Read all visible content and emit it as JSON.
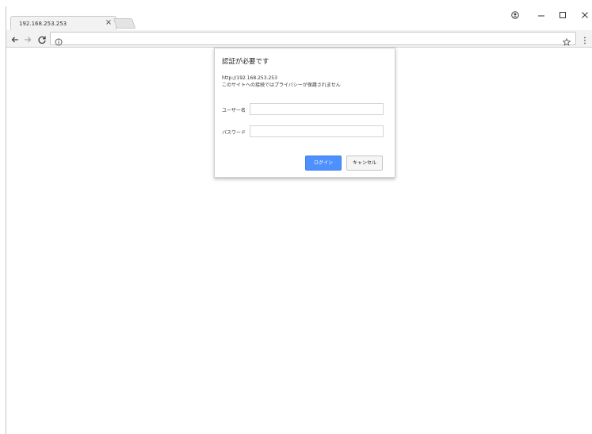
{
  "browser": {
    "tab": {
      "title": "192.168.253.253",
      "close_glyph": "×"
    },
    "window_controls": {
      "profile_icon": "profile-icon",
      "minimize_glyph": "–",
      "maximize_glyph": "☐",
      "close_glyph": "✕"
    },
    "toolbar": {
      "back_icon": "back-arrow-icon",
      "forward_icon": "forward-arrow-icon",
      "reload_icon": "reload-icon",
      "address_value": "",
      "info_icon": "info-icon",
      "star_icon": "star-icon",
      "menu_icon": "menu-icon"
    }
  },
  "auth_dialog": {
    "title": "認証が必要です",
    "url": "http://192.168.253.253",
    "warning": "このサイトへの接続ではプライバシーが保護されません",
    "username_label": "ユーザー名",
    "username_value": "",
    "password_label": "パスワード",
    "password_value": "",
    "login_button": "ログイン",
    "cancel_button": "キャンセル",
    "login_color": "#4d90fe"
  }
}
